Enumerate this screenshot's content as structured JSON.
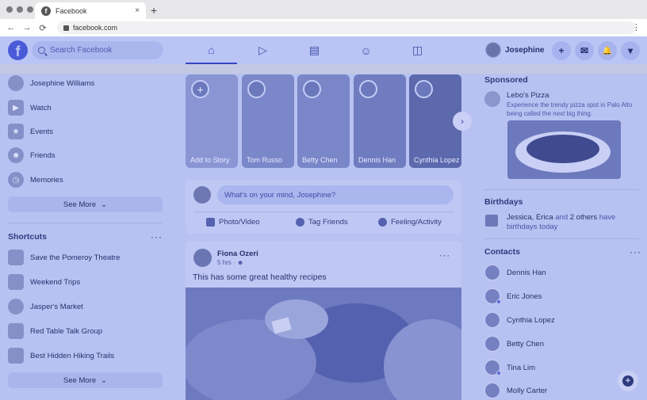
{
  "browser": {
    "tab_title": "Facebook",
    "tab_close": "×",
    "new_tab": "+",
    "url": "facebook.com",
    "back": "←",
    "forward": "→",
    "reload": "⟳",
    "menu": "⋮"
  },
  "header": {
    "logo": "f",
    "search_placeholder": "Search Facebook",
    "nav": [
      {
        "icon": "home-icon",
        "glyph": "⌂"
      },
      {
        "icon": "watch-icon",
        "glyph": "▷"
      },
      {
        "icon": "marketplace-icon",
        "glyph": "▤"
      },
      {
        "icon": "groups-icon",
        "glyph": "☺"
      },
      {
        "icon": "gaming-icon",
        "glyph": "◫"
      }
    ],
    "profile_name": "Josephine",
    "create": "+",
    "messenger": "✉",
    "notifications": "🔔",
    "account": "▾"
  },
  "left": {
    "items": [
      {
        "label": "Josephine Williams",
        "icon": "profile-avatar",
        "glyph": ""
      },
      {
        "label": "Watch",
        "icon": "watch-icon",
        "glyph": "▶"
      },
      {
        "label": "Events",
        "icon": "events-icon",
        "glyph": "★"
      },
      {
        "label": "Friends",
        "icon": "friends-icon",
        "glyph": "☻"
      },
      {
        "label": "Memories",
        "icon": "memories-icon",
        "glyph": "◷"
      }
    ],
    "see_more_1": "See More",
    "shortcuts_title": "Shortcuts",
    "shortcuts_dots": "···",
    "shortcuts": [
      {
        "label": "Save the Pomeroy Theatre"
      },
      {
        "label": "Weekend Trips"
      },
      {
        "label": "Jasper's Market"
      },
      {
        "label": "Red Table Talk Group"
      },
      {
        "label": "Best Hidden Hiking Trails"
      }
    ],
    "see_more_2": "See More",
    "chevron": "⌄"
  },
  "stories": [
    {
      "name": "Add to Story",
      "ring": "+"
    },
    {
      "name": "Tom Russo",
      "ring": ""
    },
    {
      "name": "Betty Chen",
      "ring": ""
    },
    {
      "name": "Dennis Han",
      "ring": ""
    },
    {
      "name": "Cynthia Lopez",
      "ring": ""
    }
  ],
  "stories_next": "›",
  "composer": {
    "placeholder": "What's on your mind, Josephine?",
    "photo": "Photo/Video",
    "tag": "Tag Friends",
    "feeling": "Feeling/Activity"
  },
  "post": {
    "author": "Fiona Ozeri",
    "meta": "5 hrs · ",
    "meta_icon": "friends-audience-icon",
    "text": "This has some great healthy recipes",
    "dots": "···"
  },
  "right": {
    "sponsored_title": "Sponsored",
    "ad_name": "Lebo's Pizza",
    "ad_desc": "Experience the trendy pizza spot in Palo Alto being called the next big thing.",
    "birthdays_title": "Birthdays",
    "bday_names": "Jessica, Erica",
    "bday_and": " and ",
    "bday_others": "2 others",
    "bday_rest": " have birthdays today",
    "contacts_title": "Contacts",
    "contacts_dots": "···",
    "contacts": [
      {
        "name": "Dennis Han",
        "online": false
      },
      {
        "name": "Eric Jones",
        "online": true
      },
      {
        "name": "Cynthia Lopez",
        "online": false
      },
      {
        "name": "Betty Chen",
        "online": false
      },
      {
        "name": "Tina Lim",
        "online": true
      },
      {
        "name": "Molly Carter",
        "online": false
      }
    ],
    "fab": "+"
  },
  "colors": {
    "overlay": "#b8c2f2",
    "accent": "#3848c4",
    "text": "#26306b"
  }
}
